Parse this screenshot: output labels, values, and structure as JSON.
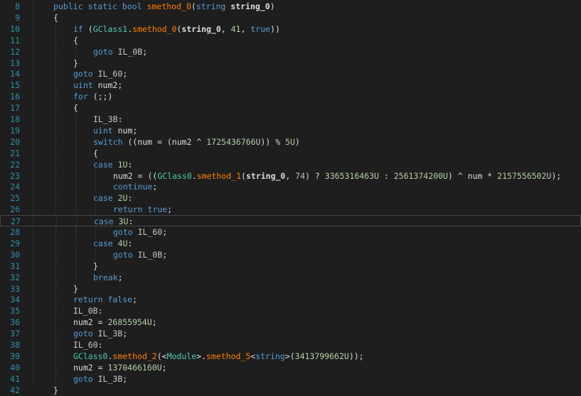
{
  "lines": [
    {
      "n": "8",
      "indent": 0,
      "tokens": [
        [
          "k",
          "public static bool "
        ],
        [
          "m2",
          "smethod_0"
        ],
        [
          "p",
          "("
        ],
        [
          "k",
          "string "
        ],
        [
          "b",
          "string_0"
        ],
        [
          "p",
          ")"
        ]
      ]
    },
    {
      "n": "9",
      "indent": 0,
      "tokens": [
        [
          "p",
          "{"
        ]
      ]
    },
    {
      "n": "10",
      "indent": 1,
      "tokens": [
        [
          "k",
          "if "
        ],
        [
          "p",
          "("
        ],
        [
          "gc",
          "GClass1"
        ],
        [
          "p",
          "."
        ],
        [
          "m2",
          "smethod_0"
        ],
        [
          "p",
          "("
        ],
        [
          "b",
          "string_0"
        ],
        [
          "p",
          ", "
        ],
        [
          "num",
          "41"
        ],
        [
          "p",
          ", "
        ],
        [
          "k",
          "true"
        ],
        [
          "p",
          "))"
        ]
      ]
    },
    {
      "n": "11",
      "indent": 1,
      "tokens": [
        [
          "p",
          "{"
        ]
      ]
    },
    {
      "n": "12",
      "indent": 2,
      "tokens": [
        [
          "k",
          "goto "
        ],
        [
          "lbl",
          "IL_0B"
        ],
        [
          "p",
          ";"
        ]
      ]
    },
    {
      "n": "13",
      "indent": 1,
      "tokens": [
        [
          "p",
          "}"
        ]
      ]
    },
    {
      "n": "14",
      "indent": 1,
      "tokens": [
        [
          "k",
          "goto "
        ],
        [
          "lbl",
          "IL_60"
        ],
        [
          "p",
          ";"
        ]
      ]
    },
    {
      "n": "15",
      "indent": 1,
      "tokens": [
        [
          "k",
          "uint "
        ],
        [
          "p",
          "num2;"
        ]
      ]
    },
    {
      "n": "16",
      "indent": 1,
      "tokens": [
        [
          "k",
          "for "
        ],
        [
          "p",
          "(;;)"
        ]
      ]
    },
    {
      "n": "17",
      "indent": 1,
      "tokens": [
        [
          "p",
          "{"
        ]
      ]
    },
    {
      "n": "18",
      "indent": 2,
      "tokens": [
        [
          "lbl",
          "IL_3B"
        ],
        [
          "p",
          ":"
        ]
      ]
    },
    {
      "n": "19",
      "indent": 2,
      "tokens": [
        [
          "k",
          "uint "
        ],
        [
          "p",
          "num;"
        ]
      ]
    },
    {
      "n": "20",
      "indent": 2,
      "tokens": [
        [
          "k",
          "switch "
        ],
        [
          "p",
          "((num = (num2 ^ "
        ],
        [
          "num",
          "1725436766U"
        ],
        [
          "p",
          ")) % "
        ],
        [
          "num",
          "5U"
        ],
        [
          "p",
          ")"
        ]
      ]
    },
    {
      "n": "21",
      "indent": 2,
      "tokens": [
        [
          "p",
          "{"
        ]
      ]
    },
    {
      "n": "22",
      "indent": 2,
      "tokens": [
        [
          "k",
          "case "
        ],
        [
          "num",
          "1U"
        ],
        [
          "p",
          ":"
        ]
      ]
    },
    {
      "n": "23",
      "indent": 3,
      "tokens": [
        [
          "p",
          "num2 = (("
        ],
        [
          "gc",
          "GClass0"
        ],
        [
          "p",
          "."
        ],
        [
          "m2",
          "smethod_1"
        ],
        [
          "p",
          "("
        ],
        [
          "b",
          "string_0"
        ],
        [
          "p",
          ", "
        ],
        [
          "num",
          "74"
        ],
        [
          "p",
          ") ? "
        ],
        [
          "num",
          "3365316463U"
        ],
        [
          "p",
          " : "
        ],
        [
          "num",
          "2561374200U"
        ],
        [
          "p",
          ") ^ num * "
        ],
        [
          "num",
          "2157556502U"
        ],
        [
          "p",
          ");"
        ]
      ]
    },
    {
      "n": "24",
      "indent": 3,
      "tokens": [
        [
          "k",
          "continue"
        ],
        [
          "p",
          ";"
        ]
      ]
    },
    {
      "n": "25",
      "indent": 2,
      "tokens": [
        [
          "k",
          "case "
        ],
        [
          "num",
          "2U"
        ],
        [
          "p",
          ":"
        ]
      ]
    },
    {
      "n": "26",
      "indent": 3,
      "tokens": [
        [
          "k",
          "return true"
        ],
        [
          "p",
          ";"
        ]
      ]
    },
    {
      "n": "27",
      "indent": 2,
      "current": true,
      "tokens": [
        [
          "k",
          "case "
        ],
        [
          "num",
          "3U"
        ],
        [
          "p",
          ":"
        ]
      ]
    },
    {
      "n": "28",
      "indent": 3,
      "tokens": [
        [
          "k",
          "goto "
        ],
        [
          "lbl",
          "IL_60"
        ],
        [
          "p",
          ";"
        ]
      ]
    },
    {
      "n": "29",
      "indent": 2,
      "tokens": [
        [
          "k",
          "case "
        ],
        [
          "num",
          "4U"
        ],
        [
          "p",
          ":"
        ]
      ]
    },
    {
      "n": "30",
      "indent": 3,
      "tokens": [
        [
          "k",
          "goto "
        ],
        [
          "lbl",
          "IL_0B"
        ],
        [
          "p",
          ";"
        ]
      ]
    },
    {
      "n": "31",
      "indent": 2,
      "tokens": [
        [
          "p",
          "}"
        ]
      ]
    },
    {
      "n": "32",
      "indent": 2,
      "tokens": [
        [
          "k",
          "break"
        ],
        [
          "p",
          ";"
        ]
      ]
    },
    {
      "n": "33",
      "indent": 1,
      "tokens": [
        [
          "p",
          "}"
        ]
      ]
    },
    {
      "n": "34",
      "indent": 1,
      "tokens": [
        [
          "k",
          "return false"
        ],
        [
          "p",
          ";"
        ]
      ]
    },
    {
      "n": "35",
      "indent": 1,
      "tokens": [
        [
          "lbl",
          "IL_0B"
        ],
        [
          "p",
          ":"
        ]
      ]
    },
    {
      "n": "36",
      "indent": 1,
      "tokens": [
        [
          "p",
          "num2 = "
        ],
        [
          "num",
          "26855954U"
        ],
        [
          "p",
          ";"
        ]
      ]
    },
    {
      "n": "37",
      "indent": 1,
      "tokens": [
        [
          "k",
          "goto "
        ],
        [
          "lbl",
          "IL_3B"
        ],
        [
          "p",
          ";"
        ]
      ]
    },
    {
      "n": "38",
      "indent": 1,
      "tokens": [
        [
          "lbl",
          "IL_60"
        ],
        [
          "p",
          ":"
        ]
      ]
    },
    {
      "n": "39",
      "indent": 1,
      "tokens": [
        [
          "gc",
          "GClass0"
        ],
        [
          "p",
          "."
        ],
        [
          "m2",
          "smethod_2"
        ],
        [
          "p",
          "(<"
        ],
        [
          "t",
          "Module"
        ],
        [
          "p",
          ">."
        ],
        [
          "m2",
          "smethod_5"
        ],
        [
          "p",
          "<"
        ],
        [
          "k",
          "string"
        ],
        [
          "p",
          ">("
        ],
        [
          "num",
          "3413799662U"
        ],
        [
          "p",
          "));"
        ]
      ]
    },
    {
      "n": "40",
      "indent": 1,
      "tokens": [
        [
          "p",
          "num2 = "
        ],
        [
          "num",
          "1370466160U"
        ],
        [
          "p",
          ";"
        ]
      ]
    },
    {
      "n": "41",
      "indent": 1,
      "tokens": [
        [
          "k",
          "goto "
        ],
        [
          "lbl",
          "IL_3B"
        ],
        [
          "p",
          ";"
        ]
      ]
    },
    {
      "n": "42",
      "indent": 0,
      "tokens": [
        [
          "p",
          "}"
        ]
      ]
    }
  ],
  "colors": {
    "background": "#1e1e1e",
    "line_number": "#2b91af",
    "keyword": "#569cd6",
    "method": "#ff8000",
    "type": "#4ec9b0",
    "number": "#b5cea8",
    "text": "#dcdcdc"
  }
}
